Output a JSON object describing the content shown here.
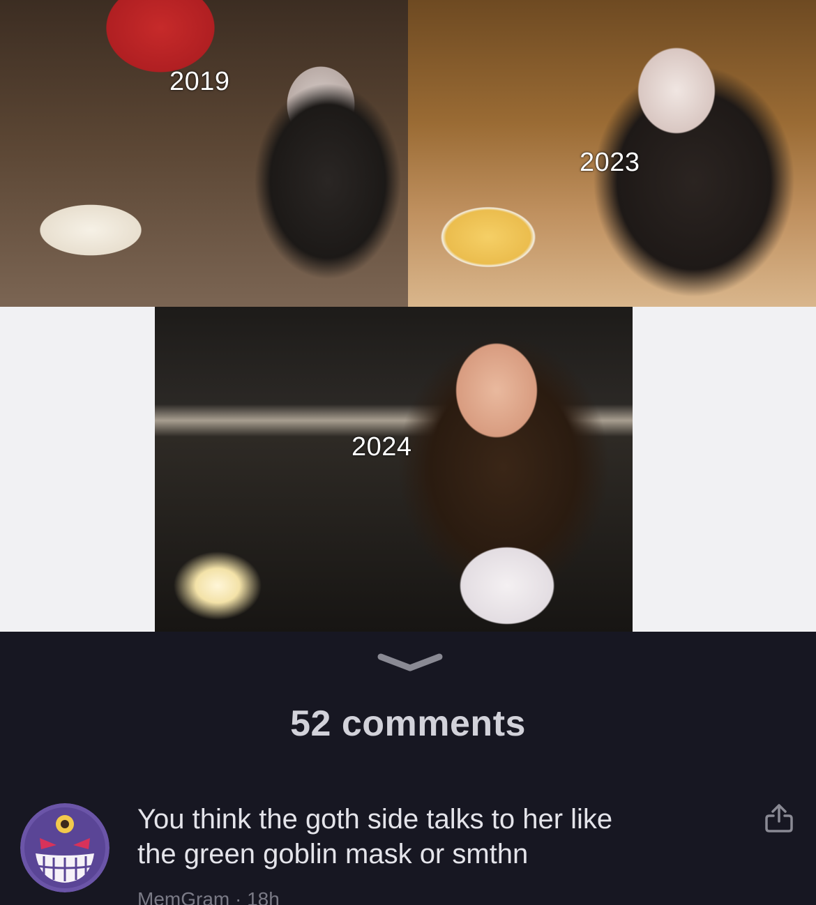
{
  "collage": {
    "photos": [
      {
        "year": "2019"
      },
      {
        "year": "2023"
      },
      {
        "year": "2024"
      }
    ]
  },
  "comments_header": {
    "count_label": "52 comments"
  },
  "comment": {
    "text_line1": "You think the goth side talks to her like",
    "text_line2": "the green goblin mask or smthn",
    "meta": "MemGram · 18h",
    "avatar_icon": "gengar-avatar-icon",
    "share_icon": "share-upload-icon"
  },
  "colors": {
    "panel_background": "#171722",
    "page_background": "#f1f1f3",
    "avatar_purple": "#6b55a8"
  }
}
